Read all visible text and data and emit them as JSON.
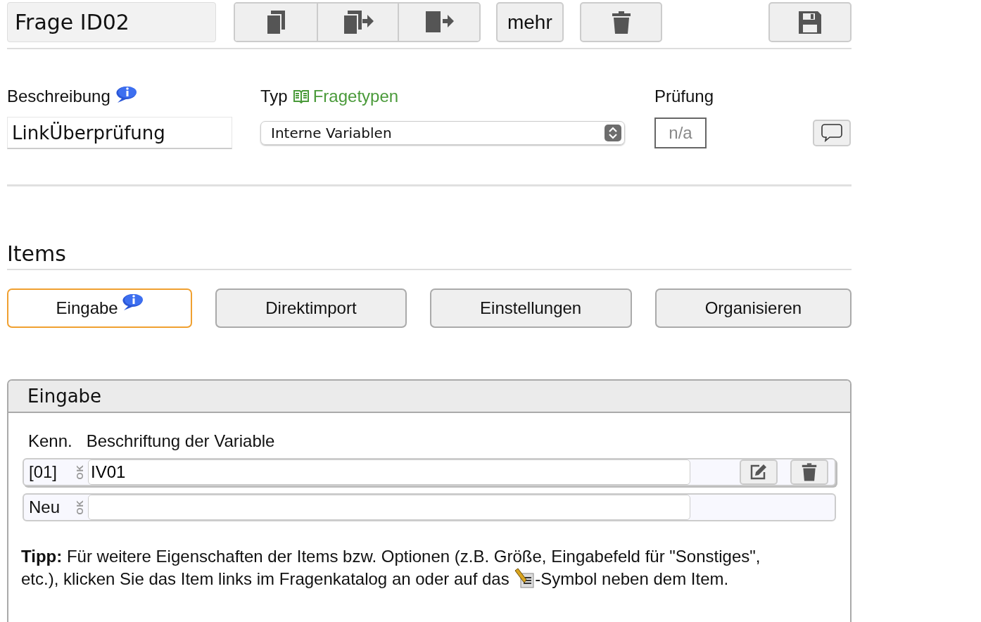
{
  "header": {
    "title": "Frage ID02",
    "more_button": "mehr"
  },
  "fields": {
    "description_label": "Beschreibung",
    "description_info": true,
    "type_label": "Typ",
    "type_link": "Fragetypen",
    "check_label": "Prüfung",
    "description_value": "LinkÜberprüfung",
    "type_value": "Interne Variablen",
    "check_value": "n/a"
  },
  "items_heading": "Items",
  "tabs": [
    {
      "label": "Eingabe",
      "selected": true,
      "info": true
    },
    {
      "label": "Direktimport",
      "selected": false,
      "info": false
    },
    {
      "label": "Einstellungen",
      "selected": false,
      "info": false
    },
    {
      "label": "Organisieren",
      "selected": false,
      "info": false
    }
  ],
  "panel": {
    "title": "Eingabe",
    "columns": [
      "Kenn.",
      "Beschriftung der Variable"
    ],
    "rows": [
      {
        "kind": "item",
        "id": "[01]",
        "ok": "OK",
        "value": "IV01"
      },
      {
        "kind": "new",
        "id": "Neu",
        "ok": "OK"
      }
    ],
    "tip": "**Tipp:** Für weitere Eigenschaften der Items bzw. Optionen (z.B. Größe, Eingabefeld für \"Sonstiges\",",
    "tip_line2": "etc.), klicken Sie das Item links im Fragenkatalog an oder auf das",
    "tip_end": "-Symbol neben dem Item."
  }
}
